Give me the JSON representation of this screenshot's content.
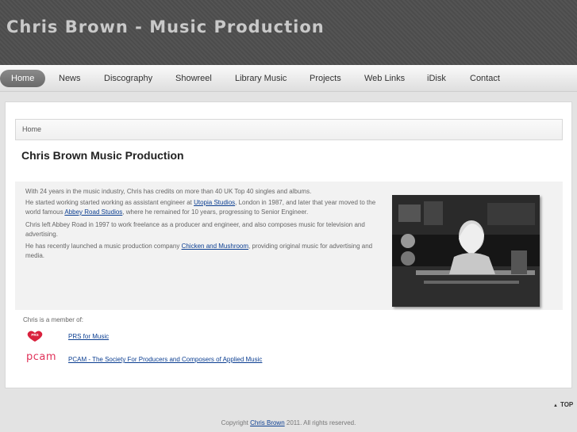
{
  "header": {
    "title": "Chris Brown - Music Production"
  },
  "nav": [
    {
      "label": "Home",
      "active": true
    },
    {
      "label": "News"
    },
    {
      "label": "Discography"
    },
    {
      "label": "Showreel"
    },
    {
      "label": "Library Music"
    },
    {
      "label": "Projects"
    },
    {
      "label": "Web Links"
    },
    {
      "label": "iDisk"
    },
    {
      "label": "Contact"
    }
  ],
  "breadcrumb": "Home",
  "page_title": "Chris Brown Music Production",
  "article": {
    "p1": "With 24 years in the music industry, Chris has credits on more than 40 UK Top 40 singles and albums.",
    "p2_pre": "He started working started working as assistant engineer at ",
    "p2_link1": "Utopia Studios",
    "p2_mid": ", London in 1987, and later that year moved to the world famous ",
    "p2_link2": "Abbey Road Studios",
    "p2_post": ", where he remained for 10 years, progressing to Senior Engineer.",
    "p3": "Chris left Abbey Road in 1997 to work freelance as a producer and engineer, and also composes music for television and advertising.",
    "p4_pre": "He has recently launched a music production company ",
    "p4_link": "Chicken and Mushroom",
    "p4_post": ", providing original music for advertising and media."
  },
  "members": {
    "intro": "Chris is a member of:",
    "orgs": [
      {
        "logo": "prs-logo",
        "logo_text": "PRS",
        "link": "PRS for Music"
      },
      {
        "logo": "pcam-logo",
        "logo_text": "pcam",
        "link": "PCAM - The Society For Producers and Composers of Applied Music"
      }
    ]
  },
  "top_link": "TOP",
  "footer": {
    "pre": "Copyright ",
    "link": "Chris Brown",
    "post": " 2011. All rights reserved."
  },
  "colors": {
    "link": "#0b3e91",
    "header_bg": "#4e4e4e",
    "pcam": "#e0335a",
    "prs": "#d9213d"
  }
}
